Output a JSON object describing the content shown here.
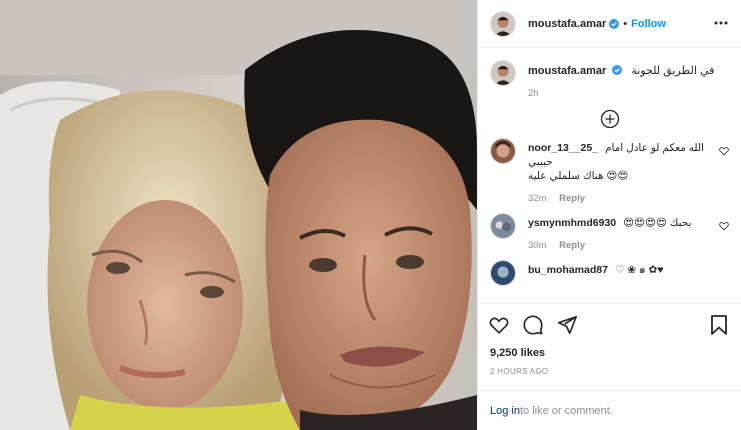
{
  "photo": {
    "alt": ""
  },
  "header": {
    "username": "moustafa.amar",
    "verified": true,
    "dot": "•",
    "follow_label": "Follow",
    "more_icon": "more-horizontal-icon"
  },
  "caption": {
    "username": "moustafa.amar",
    "text": "في الطريق للجونة",
    "time": "2h"
  },
  "load_more_icon": "plus-circle-icon",
  "comments": [
    {
      "username": "noor_13__25_",
      "text": "الله معكم لو عادل امام حبيبي",
      "text2": "😍😍 هناك سلملي عليه",
      "time": "32m",
      "reply_label": "Reply"
    },
    {
      "username": "ysmynmhmd6930",
      "text": "بحبك 😍😍😍😍",
      "time": "30m",
      "reply_label": "Reply"
    },
    {
      "username": "bu_mohamad87",
      "text": "♡ ❀ ๑ ✿♥",
      "time": "",
      "reply_label": ""
    }
  ],
  "actions": {
    "like_icon": "heart-icon",
    "comment_icon": "comment-icon",
    "share_icon": "paper-plane-icon",
    "save_icon": "bookmark-icon"
  },
  "likes": "9,250 likes",
  "posted": "2 HOURS AGO",
  "login": {
    "link": "Log in",
    "rest": " to like or comment."
  },
  "colors": {
    "accent": "#0095f6",
    "text": "#262626",
    "muted": "#8e8e8e",
    "border": "#efefef",
    "link": "#00376b"
  }
}
